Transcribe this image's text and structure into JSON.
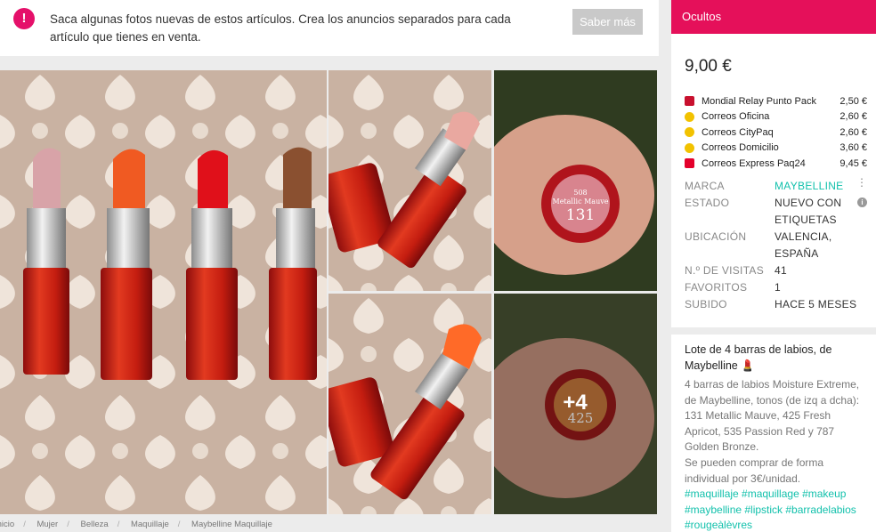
{
  "notice": {
    "text": "Saca algunas fotos nuevas de estos artículos. Crea los anuncios separados para cada artículo que tienes en venta.",
    "button_label": "Saber más"
  },
  "gallery": {
    "more_count": "+4",
    "cap1_line1": "508",
    "cap1_line2": "Metallic Mauve",
    "cap1_num": "131",
    "cap2_num": "425"
  },
  "breadcrumb": [
    "Inicio",
    "Mujer",
    "Belleza",
    "Maquillaje",
    "Maybelline Maquillaje"
  ],
  "status_banner": "Ocultos",
  "price": "9,00 €",
  "shipping": [
    {
      "name": "Mondial Relay Punto Pack",
      "price": "2,50 €",
      "icon": "mondial-relay-icon",
      "color": "#c8102e"
    },
    {
      "name": "Correos Oficina",
      "price": "2,60 €",
      "icon": "correos-icon",
      "color": "#f2c200"
    },
    {
      "name": "Correos CityPaq",
      "price": "2,60 €",
      "icon": "correos-icon",
      "color": "#f2c200"
    },
    {
      "name": "Correos Domicilio",
      "price": "3,60 €",
      "icon": "correos-icon",
      "color": "#f2c200"
    },
    {
      "name": "Correos Express Paq24",
      "price": "9,45 €",
      "icon": "correos-express-icon",
      "color": "#e4002b"
    }
  ],
  "details": {
    "brand_label": "MARCA",
    "brand_value": "MAYBELLINE",
    "condition_label": "ESTADO",
    "condition_value": "NUEVO CON ETIQUETAS",
    "location_label": "UBICACIÓN",
    "location_value": "VALENCIA, ESPAÑA",
    "visits_label": "N.º DE VISITAS",
    "visits_value": "41",
    "favorites_label": "FAVORITOS",
    "favorites_value": "1",
    "uploaded_label": "SUBIDO",
    "uploaded_value": "HACE 5 MESES"
  },
  "description": {
    "title": "Lote de 4 barras de labios, de Maybelline 💄",
    "body1": "4 barras de labios Moisture Extreme, de Maybelline, tonos (de izq a dcha): 131 Metallic Mauve, 425 Fresh Apricot, 535 Passion Red y 787 Golden Bronze.",
    "body2": "Se pueden comprar de forma individual por 3€/unidad.",
    "tags": "#maquillaje #maquillage #makeup #maybelline #lipstick #barradelabios #rougeàlèvres"
  },
  "colors": {
    "accent": "#e5105a",
    "teal": "#13c1ac"
  }
}
